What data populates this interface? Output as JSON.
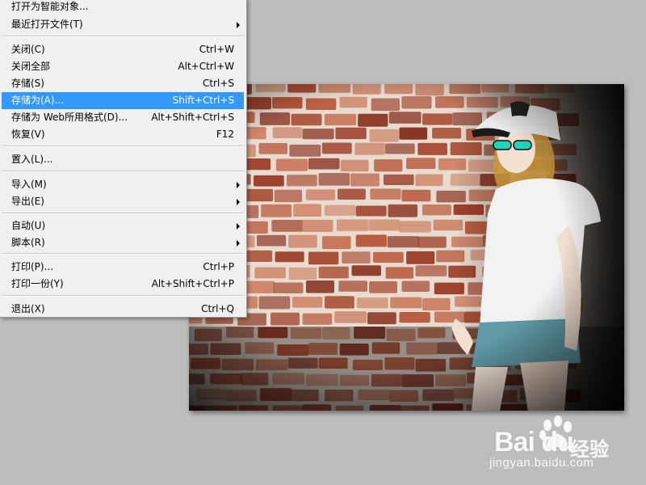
{
  "file_menu": {
    "items": [
      {
        "label": "打开为智能对象...",
        "shortcut": "",
        "submenu": false
      },
      {
        "label": "最近打开文件(T)",
        "shortcut": "",
        "submenu": true
      },
      {
        "label": "关闭(C)",
        "shortcut": "Ctrl+W",
        "submenu": false
      },
      {
        "label": "关闭全部",
        "shortcut": "Alt+Ctrl+W",
        "submenu": false
      },
      {
        "label": "存储(S)",
        "shortcut": "Ctrl+S",
        "submenu": false
      },
      {
        "label": "存储为(A)...",
        "shortcut": "Shift+Ctrl+S",
        "submenu": false,
        "highlighted": true
      },
      {
        "label": "存储为 Web所用格式(D)...",
        "shortcut": "Alt+Shift+Ctrl+S",
        "submenu": false
      },
      {
        "label": "恢复(V)",
        "shortcut": "F12",
        "submenu": false
      },
      {
        "label": "置入(L)...",
        "shortcut": "",
        "submenu": false
      },
      {
        "label": "导入(M)",
        "shortcut": "",
        "submenu": true
      },
      {
        "label": "导出(E)",
        "shortcut": "",
        "submenu": true
      },
      {
        "label": "自动(U)",
        "shortcut": "",
        "submenu": true
      },
      {
        "label": "脚本(R)",
        "shortcut": "",
        "submenu": true
      },
      {
        "label": "打印(P)...",
        "shortcut": "Ctrl+P",
        "submenu": false
      },
      {
        "label": "打印一份(Y)",
        "shortcut": "Alt+Shift+Ctrl+P",
        "submenu": false
      },
      {
        "label": "退出(X)",
        "shortcut": "Ctrl+Q",
        "submenu": false
      }
    ]
  },
  "watermark": {
    "brand": "Bai du",
    "chinese": "经验",
    "url": "jingyan.baidu.com"
  },
  "colors": {
    "workspace_bg": "#bdbdbd",
    "menu_bg": "#f0f0f0",
    "highlight": "#3399ff"
  }
}
